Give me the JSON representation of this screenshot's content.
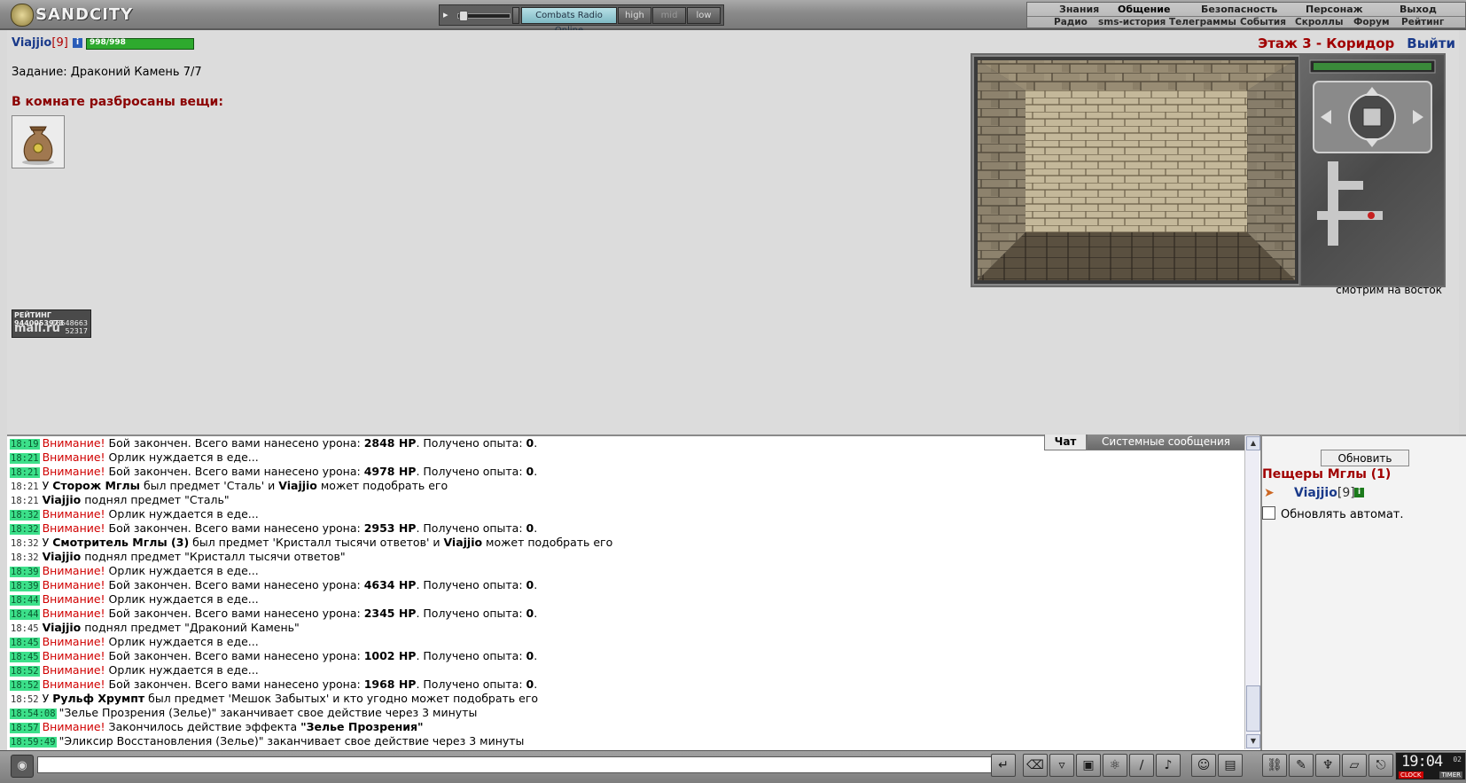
{
  "app": {
    "logo_text": "SANDCITY"
  },
  "radio": {
    "station": "Combats Radio Online",
    "high": "high",
    "mid": "mid",
    "low": "low",
    "speaker_icon": "speaker-icon"
  },
  "menu": {
    "main": [
      "Знания",
      "Общение",
      "Безопасность",
      "Персонаж",
      "Выход"
    ],
    "active": "Общение",
    "sub": [
      "Радио",
      "sms-история",
      "Телеграммы",
      "События",
      "Скроллы",
      "Форум",
      "Рейтинг"
    ]
  },
  "player": {
    "name": "Viajjio",
    "level": "[9]",
    "info": "i",
    "hp": "998/998",
    "hp_fraction": 1.0
  },
  "task": "Задание: Драконий Камень 7/7",
  "things_title": "В комнате разбросаны вещи:",
  "location": {
    "room": "Этаж 3 - Коридор",
    "exit": "Выйти",
    "facing": "смотрим на восток"
  },
  "rating": {
    "label": "РЕЙТИНГ",
    "n1": "9440053973",
    "brand": "mail.ru",
    "n2": "18548663",
    "n3": "52317"
  },
  "chat": {
    "tabs": {
      "chat": "Чат",
      "system": "Системные сообщения"
    },
    "lines": [
      {
        "t": "18:19",
        "hl": true,
        "parts": [
          {
            "s": "Внимание!",
            "c": "att"
          },
          {
            "s": " Бой закончен. Всего вами нанесено урона: "
          },
          {
            "s": "2848 HP",
            "b": true
          },
          {
            "s": ". Получено опыта: "
          },
          {
            "s": "0",
            "b": true
          },
          {
            "s": "."
          }
        ]
      },
      {
        "t": "18:21",
        "hl": true,
        "parts": [
          {
            "s": "Внимание!",
            "c": "att"
          },
          {
            "s": " Орлик нуждается в еде..."
          }
        ]
      },
      {
        "t": "18:21",
        "hl": true,
        "parts": [
          {
            "s": "Внимание!",
            "c": "att"
          },
          {
            "s": " Бой закончен. Всего вами нанесено урона: "
          },
          {
            "s": "4978 HP",
            "b": true
          },
          {
            "s": ". Получено опыта: "
          },
          {
            "s": "0",
            "b": true
          },
          {
            "s": "."
          }
        ]
      },
      {
        "t": "18:21",
        "hl": false,
        "parts": [
          {
            "s": "У "
          },
          {
            "s": "Сторож Мглы",
            "b": true
          },
          {
            "s": " был предмет 'Сталь' и "
          },
          {
            "s": "Viajjio",
            "b": true
          },
          {
            "s": " может подобрать его"
          }
        ]
      },
      {
        "t": "18:21",
        "hl": false,
        "parts": [
          {
            "s": "Viajjio",
            "b": true
          },
          {
            "s": " поднял предмет \"Сталь\""
          }
        ]
      },
      {
        "t": "18:32",
        "hl": true,
        "parts": [
          {
            "s": "Внимание!",
            "c": "att"
          },
          {
            "s": " Орлик нуждается в еде..."
          }
        ]
      },
      {
        "t": "18:32",
        "hl": true,
        "parts": [
          {
            "s": "Внимание!",
            "c": "att"
          },
          {
            "s": " Бой закончен. Всего вами нанесено урона: "
          },
          {
            "s": "2953 HP",
            "b": true
          },
          {
            "s": ". Получено опыта: "
          },
          {
            "s": "0",
            "b": true
          },
          {
            "s": "."
          }
        ]
      },
      {
        "t": "18:32",
        "hl": false,
        "parts": [
          {
            "s": "У "
          },
          {
            "s": "Смотритель Мглы (3)",
            "b": true
          },
          {
            "s": " был предмет 'Кристалл тысячи ответов' и "
          },
          {
            "s": "Viajjio",
            "b": true
          },
          {
            "s": " может подобрать его"
          }
        ]
      },
      {
        "t": "18:32",
        "hl": false,
        "parts": [
          {
            "s": "Viajjio",
            "b": true
          },
          {
            "s": " поднял предмет \"Кристалл тысячи ответов\""
          }
        ]
      },
      {
        "t": "18:39",
        "hl": true,
        "parts": [
          {
            "s": "Внимание!",
            "c": "att"
          },
          {
            "s": " Орлик нуждается в еде..."
          }
        ]
      },
      {
        "t": "18:39",
        "hl": true,
        "parts": [
          {
            "s": "Внимание!",
            "c": "att"
          },
          {
            "s": " Бой закончен. Всего вами нанесено урона: "
          },
          {
            "s": "4634 HP",
            "b": true
          },
          {
            "s": ". Получено опыта: "
          },
          {
            "s": "0",
            "b": true
          },
          {
            "s": "."
          }
        ]
      },
      {
        "t": "18:44",
        "hl": true,
        "parts": [
          {
            "s": "Внимание!",
            "c": "att"
          },
          {
            "s": " Орлик нуждается в еде..."
          }
        ]
      },
      {
        "t": "18:44",
        "hl": true,
        "parts": [
          {
            "s": "Внимание!",
            "c": "att"
          },
          {
            "s": " Бой закончен. Всего вами нанесено урона: "
          },
          {
            "s": "2345 HP",
            "b": true
          },
          {
            "s": ". Получено опыта: "
          },
          {
            "s": "0",
            "b": true
          },
          {
            "s": "."
          }
        ]
      },
      {
        "t": "18:45",
        "hl": false,
        "parts": [
          {
            "s": "Viajjio",
            "b": true
          },
          {
            "s": " поднял предмет \"Драконий Камень\""
          }
        ]
      },
      {
        "t": "18:45",
        "hl": true,
        "parts": [
          {
            "s": "Внимание!",
            "c": "att"
          },
          {
            "s": " Орлик нуждается в еде..."
          }
        ]
      },
      {
        "t": "18:45",
        "hl": true,
        "parts": [
          {
            "s": "Внимание!",
            "c": "att"
          },
          {
            "s": " Бой закончен. Всего вами нанесено урона: "
          },
          {
            "s": "1002 HP",
            "b": true
          },
          {
            "s": ". Получено опыта: "
          },
          {
            "s": "0",
            "b": true
          },
          {
            "s": "."
          }
        ]
      },
      {
        "t": "18:52",
        "hl": true,
        "parts": [
          {
            "s": "Внимание!",
            "c": "att"
          },
          {
            "s": " Орлик нуждается в еде..."
          }
        ]
      },
      {
        "t": "18:52",
        "hl": true,
        "parts": [
          {
            "s": "Внимание!",
            "c": "att"
          },
          {
            "s": " Бой закончен. Всего вами нанесено урона: "
          },
          {
            "s": "1968 HP",
            "b": true
          },
          {
            "s": ". Получено опыта: "
          },
          {
            "s": "0",
            "b": true
          },
          {
            "s": "."
          }
        ]
      },
      {
        "t": "18:52",
        "hl": false,
        "parts": [
          {
            "s": "У "
          },
          {
            "s": "Рульф Хрумпт",
            "b": true
          },
          {
            "s": " был предмет 'Мешок Забытых' и кто угодно может подобрать его"
          }
        ]
      },
      {
        "t": "18:54:08",
        "hl": true,
        "parts": [
          {
            "s": "\"Зелье Прозрения (Зелье)\" заканчивает свое действие через 3 минуты"
          }
        ]
      },
      {
        "t": "18:57",
        "hl": true,
        "parts": [
          {
            "s": "Внимание!",
            "c": "att"
          },
          {
            "s": " Закончилось действие эффекта "
          },
          {
            "s": "\"Зелье Прозрения\"",
            "b": true
          }
        ]
      },
      {
        "t": "18:59:49",
        "hl": true,
        "parts": [
          {
            "s": "\"Эликсир Восстановления (Зелье)\" заканчивает свое действие через 3 минуты"
          }
        ]
      }
    ]
  },
  "side": {
    "refresh": "Обновить",
    "cave": "Пещеры Мглы (1)",
    "user_name": "Viajjio",
    "user_level": "[9]",
    "user_info": "i",
    "auto_refresh": "Обновлять автомат."
  },
  "bottom": {
    "message_value": "",
    "clock_time": "19:04",
    "clock_sec": "02",
    "clock_label": "CLOCK",
    "timer_label": "TIMER",
    "tools_left": [
      "enter-icon",
      "eraser-icon",
      "filter-icon",
      "save-icon",
      "dance-icon",
      "translit-icon",
      "music-icon",
      "smile-icon",
      "scroll-icon"
    ],
    "tools_right": [
      "bag-icon",
      "scroll-map-icon",
      "wings-icon",
      "chest-icon",
      "exit-door-icon"
    ]
  },
  "colors": {
    "attention": "#d00000",
    "timestamp_highlight": "#3ce08a",
    "player_name": "#1a3a8a",
    "room_title": "#a00000"
  }
}
